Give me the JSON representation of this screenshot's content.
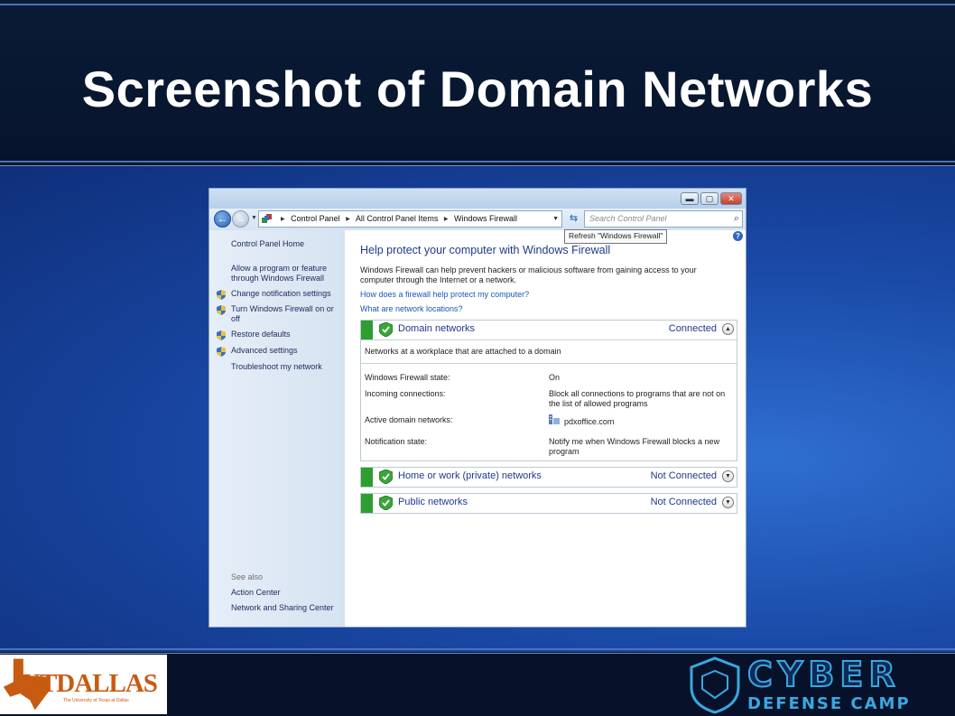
{
  "slide": {
    "title": "Screenshot of Domain Networks"
  },
  "window": {
    "address": {
      "crumbs": [
        "Control Panel",
        "All Control Panel Items",
        "Windows Firewall"
      ],
      "icon": "control-panel-icon"
    },
    "search": {
      "placeholder": "Search Control Panel"
    },
    "tooltip": "Refresh \"Windows Firewall\"",
    "left_pane": {
      "home": "Control Panel Home",
      "links": [
        {
          "label": "Allow a program or feature through Windows Firewall",
          "icon": ""
        },
        {
          "label": "Change notification settings",
          "icon": "shield-icon"
        },
        {
          "label": "Turn Windows Firewall on or off",
          "icon": "shield-icon"
        },
        {
          "label": "Restore defaults",
          "icon": "shield-icon"
        },
        {
          "label": "Advanced settings",
          "icon": "shield-icon"
        },
        {
          "label": "Troubleshoot my network",
          "icon": ""
        }
      ],
      "see_also": {
        "heading": "See also",
        "links": [
          "Action Center",
          "Network and Sharing Center"
        ]
      }
    },
    "main": {
      "help_icon": "?",
      "title": "Help protect your computer with Windows Firewall",
      "description": "Windows Firewall can help prevent hackers or malicious software from gaining access to your computer through the Internet or a network.",
      "links": [
        "How does a firewall help protect my computer?",
        "What are network locations?"
      ],
      "panels": [
        {
          "name": "Domain networks",
          "status": "Connected",
          "expanded": true,
          "description": "Networks at a workplace that are attached to a domain",
          "details": [
            {
              "label": "Windows Firewall state:",
              "value": "On"
            },
            {
              "label": "Incoming connections:",
              "value": "Block all connections to programs that are not on the list of allowed programs"
            },
            {
              "label": "Active domain networks:",
              "value": "pdxoffice.com"
            },
            {
              "label": "Notification state:",
              "value": "Notify me when Windows Firewall blocks a new program"
            }
          ]
        },
        {
          "name": "Home or work (private) networks",
          "status": "Not Connected",
          "expanded": false
        },
        {
          "name": "Public networks",
          "status": "Not Connected",
          "expanded": false
        }
      ]
    }
  },
  "footer": {
    "left_logo_text": "UTDALLAS",
    "left_logo_subtext": "The University of Texas at Dallas",
    "right_logo_text": "CYBER",
    "right_logo_subtext": "DEFENSE CAMP"
  },
  "colors": {
    "accent_green": "#2e9e31",
    "link_blue": "#1a55b5",
    "heading_blue": "#1e3a8a",
    "utd_orange": "#c75b12"
  }
}
